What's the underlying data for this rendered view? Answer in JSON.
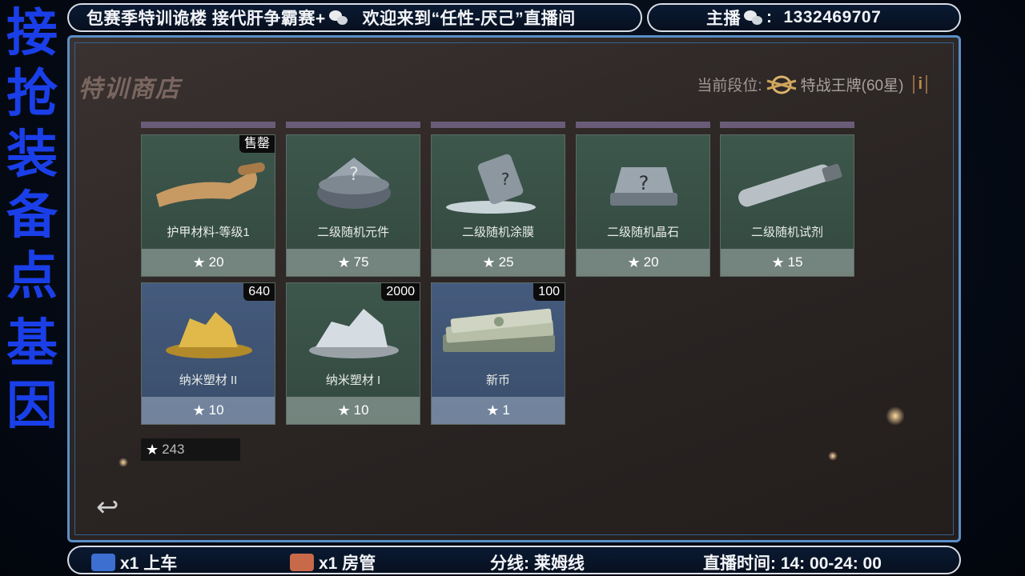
{
  "side_text": [
    "接",
    "抢",
    "装",
    "备",
    "点",
    "基",
    "因"
  ],
  "top_banner": {
    "left_text": "包赛季特训诡楼 接代肝争霸赛+",
    "center_text": "欢迎来到“任性-厌己”直播间",
    "right_label": "主播",
    "right_sep": ":",
    "right_number": "1332469707"
  },
  "shop": {
    "title": "特训商店",
    "rank_label": "当前段位:",
    "rank_value": "特战王牌(60星)",
    "info_label": "i"
  },
  "items": [
    {
      "name": "护甲材料-等级1",
      "price": "20",
      "badge": "售罄",
      "bg": "green",
      "icon": "parchment-icon"
    },
    {
      "name": "二级随机元件",
      "price": "75",
      "badge": "",
      "bg": "green",
      "icon": "mystery-component-icon"
    },
    {
      "name": "二级随机涂膜",
      "price": "25",
      "badge": "",
      "bg": "green",
      "icon": "paint-bucket-icon"
    },
    {
      "name": "二级随机晶石",
      "price": "20",
      "badge": "",
      "bg": "green",
      "icon": "mystery-crystal-icon"
    },
    {
      "name": "二级随机试剂",
      "price": "15",
      "badge": "",
      "bg": "green",
      "icon": "syringe-icon"
    },
    {
      "name": "纳米塑材 II",
      "price": "10",
      "badge": "640",
      "bg": "blue",
      "icon": "gold-nano-icon"
    },
    {
      "name": "纳米塑材 I",
      "price": "10",
      "badge": "2000",
      "bg": "green",
      "icon": "silver-nano-icon"
    },
    {
      "name": "新币",
      "price": "1",
      "badge": "100",
      "bg": "blue",
      "icon": "cash-stack-icon"
    }
  ],
  "balance": "243",
  "bottom_bar": {
    "seg1": "x1 上车",
    "seg2": "x1 房管",
    "seg3": "分线: 莱姆线",
    "seg4": "直播时间: 14: 00-24: 00"
  },
  "colors": {
    "accent_blue": "#1a3fe8",
    "frame_blue": "#5a8fc7",
    "card_green": "#3d574d",
    "card_blue": "#455b7d"
  }
}
